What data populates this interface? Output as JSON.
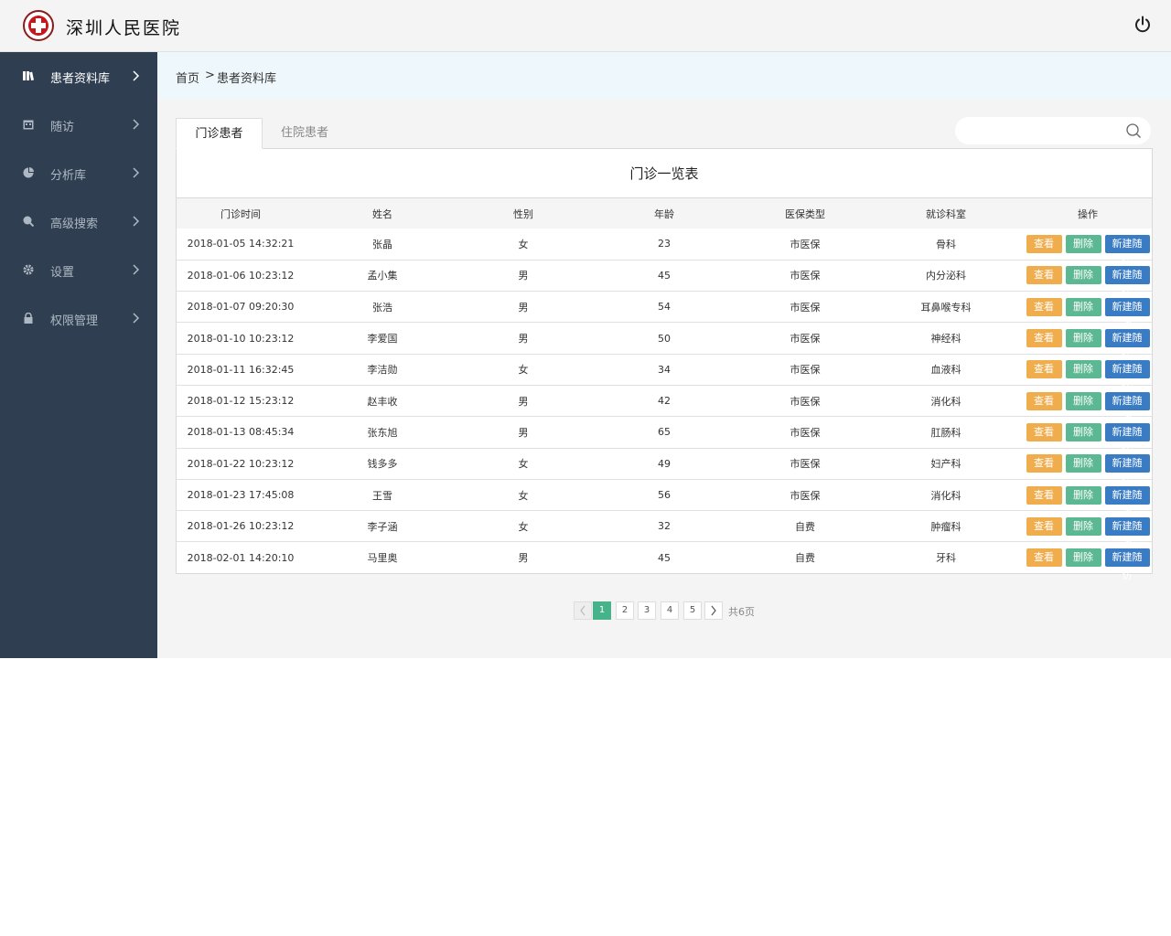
{
  "header": {
    "hospital_name": "深圳人民医院",
    "logo_icon": "hospital-red-cross-logo",
    "power_icon": "power-icon"
  },
  "sidebar": {
    "items": [
      {
        "label": "患者资料库",
        "icon": "book-icon",
        "active": true
      },
      {
        "label": "随访",
        "icon": "calendar-icon",
        "active": false
      },
      {
        "label": "分析库",
        "icon": "pie-chart-icon",
        "active": false
      },
      {
        "label": "高级搜索",
        "icon": "search-icon",
        "active": false
      },
      {
        "label": "设置",
        "icon": "gear-icon",
        "active": false
      },
      {
        "label": "权限管理",
        "icon": "lock-icon",
        "active": false
      }
    ]
  },
  "breadcrumb": {
    "home": "首页",
    "separator": ">",
    "current": "患者资料库"
  },
  "tabs": {
    "outpatient": "门诊患者",
    "inpatient": "住院患者"
  },
  "search": {
    "value": "",
    "placeholder": ""
  },
  "table": {
    "title": "门诊一览表",
    "headers": [
      "门诊时间",
      "姓名",
      "性别",
      "年龄",
      "医保类型",
      "就诊科室",
      "操作"
    ],
    "rows": [
      [
        "2018-01-05  14:32:21",
        "张晶",
        "女",
        "23",
        "市医保",
        "骨科"
      ],
      [
        "2018-01-06  10:23:12",
        "孟小集",
        "男",
        "45",
        "市医保",
        "内分泌科"
      ],
      [
        "2018-01-07  09:20:30",
        "张浩",
        "男",
        "54",
        "市医保",
        "耳鼻喉专科"
      ],
      [
        "2018-01-10  10:23:12",
        "李爱国",
        "男",
        "50",
        "市医保",
        "神经科"
      ],
      [
        "2018-01-11  16:32:45",
        "李洁勋",
        "女",
        "34",
        "市医保",
        "血液科"
      ],
      [
        "2018-01-12  15:23:12",
        "赵丰收",
        "男",
        "42",
        "市医保",
        "消化科"
      ],
      [
        "2018-01-13  08:45:34",
        "张东旭",
        "男",
        "65",
        "市医保",
        "肛肠科"
      ],
      [
        "2018-01-22  10:23:12",
        "钱多多",
        "女",
        "49",
        "市医保",
        "妇产科"
      ],
      [
        "2018-01-23  17:45:08",
        "王雪",
        "女",
        "56",
        "市医保",
        "消化科"
      ],
      [
        "2018-01-26  10:23:12",
        "李子涵",
        "女",
        "32",
        "自费",
        "肿瘤科"
      ],
      [
        "2018-02-01  14:20:10",
        "马里奥",
        "男",
        "45",
        "自费",
        "牙科"
      ]
    ],
    "actions": {
      "view": "查看",
      "delete": "删除",
      "new_followup": "新建随访"
    }
  },
  "pagination": {
    "pages": [
      "1",
      "2",
      "3",
      "4",
      "5"
    ],
    "current": "1",
    "total": "共6页"
  },
  "colors": {
    "sidebar_bg": "#2f3f51",
    "view_btn": "#f0ad4e",
    "delete_btn": "#5cb892",
    "new_btn": "#3a7cc4",
    "page_active": "#47b38b"
  }
}
